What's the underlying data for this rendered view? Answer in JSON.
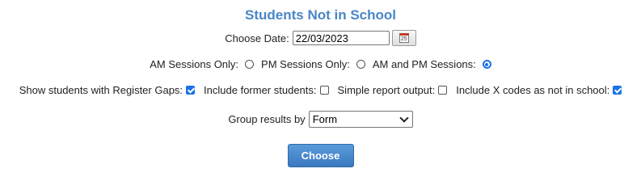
{
  "title": "Students Not in School",
  "date": {
    "label": "Choose Date:",
    "value": "22/03/2023",
    "calendar_icon_text": "25"
  },
  "sessions": {
    "am_label": "AM Sessions Only:",
    "pm_label": "PM Sessions Only:",
    "both_label": "AM and PM Sessions:",
    "selected": "both"
  },
  "options": {
    "register_gaps": {
      "label": "Show students with Register Gaps:",
      "checked": true
    },
    "former_students": {
      "label": "Include former students:",
      "checked": false
    },
    "simple_output": {
      "label": "Simple report output:",
      "checked": false
    },
    "x_codes": {
      "label": "Include X codes as not in school:",
      "checked": true
    }
  },
  "group": {
    "label": "Group results by",
    "selected": "Form"
  },
  "button": {
    "label": "Choose"
  },
  "colors": {
    "title": "#4a86c5",
    "accent": "#1a73e8",
    "button": "#4a8ad0"
  }
}
